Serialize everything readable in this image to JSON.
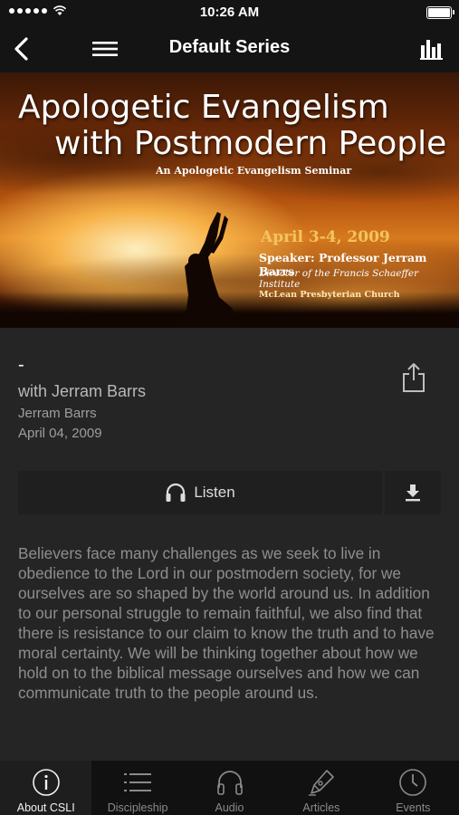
{
  "status_bar": {
    "time": "10:26 AM"
  },
  "nav": {
    "title": "Default Series"
  },
  "banner": {
    "title_line1": "Apologetic Evangelism",
    "title_line2": "with Postmodern People",
    "subtitle": "An Apologetic Evangelism Seminar",
    "date": "April 3-4, 2009",
    "speaker": "Speaker: Professor Jerram Barrs",
    "director": "Director of the Francis Schaeffer Institute",
    "church": "McLean Presbyterian Church"
  },
  "episode": {
    "title": "-",
    "subtitle": "with Jerram Barrs",
    "speaker": "Jerram Barrs",
    "date": "April 04, 2009"
  },
  "actions": {
    "listen_label": "Listen"
  },
  "description": "Believers face many challenges as we seek to live in obedience to the Lord in our postmodern society, for we ourselves are so shaped by the world around us. In addition to our personal struggle to remain faithful, we also find that there is resistance to our claim to know the truth and to have moral certainty. We will be thinking together about how we hold on to the biblical message ourselves and how we can communicate truth to the people around us.",
  "tabs": [
    {
      "label": "About CSLI",
      "icon": "info-icon",
      "active": true
    },
    {
      "label": "Discipleship",
      "icon": "list-icon",
      "active": false
    },
    {
      "label": "Audio",
      "icon": "headphones-icon",
      "active": false
    },
    {
      "label": "Articles",
      "icon": "pen-icon",
      "active": false
    },
    {
      "label": "Events",
      "icon": "clock-icon",
      "active": false
    }
  ]
}
